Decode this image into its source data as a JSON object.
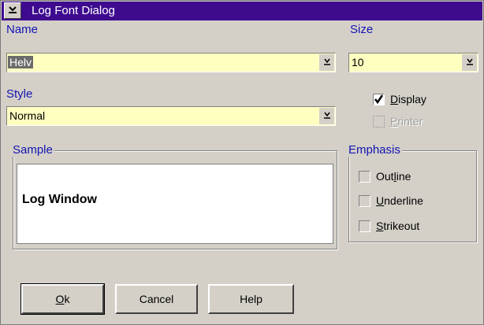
{
  "window": {
    "title": "Log Font Dialog"
  },
  "labels": {
    "name": "Name",
    "size": "Size",
    "style": "Style"
  },
  "name_field": {
    "value": "Helv"
  },
  "size_field": {
    "value": "10"
  },
  "style_field": {
    "value": "Normal"
  },
  "display": {
    "label_ul": "D",
    "label_rest": "isplay",
    "checked": true
  },
  "printer": {
    "label_ul": "P",
    "label_rest": "rinter",
    "disabled": true
  },
  "sample": {
    "legend": "Sample",
    "text": "Log Window"
  },
  "emphasis": {
    "legend": "Emphasis",
    "outline": {
      "pre": "Out",
      "ul": "l",
      "post": "ine"
    },
    "underline": {
      "pre": "",
      "ul": "U",
      "post": "nderline"
    },
    "strikeout": {
      "pre": "",
      "ul": "S",
      "post": "trikeout"
    }
  },
  "buttons": {
    "ok_ul": "O",
    "ok_rest": "k",
    "cancel": "Cancel",
    "help": "Help"
  },
  "colors": {
    "title_bar": "#3e0b8f",
    "field_bg": "#ffffc0",
    "label_text": "#1414b4"
  }
}
